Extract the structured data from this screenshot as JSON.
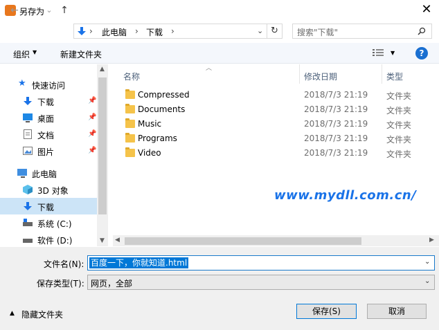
{
  "window": {
    "title": "另存为",
    "close_label": "✕"
  },
  "nav": {
    "back": "←",
    "forward": "→",
    "dropdown": "⌄",
    "up": "↑",
    "breadcrumb": [
      "此电脑",
      "下载"
    ],
    "sep": "›",
    "refresh": "↻",
    "search_placeholder": "搜索\"下载\""
  },
  "toolbar": {
    "organize": "组织",
    "new_folder": "新建文件夹",
    "help": "?"
  },
  "sidebar": {
    "items": [
      {
        "label": "快速访问",
        "icon": "star-icon",
        "pinned": false
      },
      {
        "label": "下载",
        "icon": "download-icon",
        "pinned": true
      },
      {
        "label": "桌面",
        "icon": "desktop-icon",
        "pinned": true
      },
      {
        "label": "文档",
        "icon": "document-icon",
        "pinned": true
      },
      {
        "label": "图片",
        "icon": "picture-icon",
        "pinned": true
      },
      {
        "label": "此电脑",
        "icon": "computer-icon",
        "pinned": false
      },
      {
        "label": "3D 对象",
        "icon": "cube-icon",
        "pinned": false
      },
      {
        "label": "下载",
        "icon": "download-icon",
        "pinned": false,
        "selected": true
      },
      {
        "label": "系统 (C:)",
        "icon": "drive-icon",
        "pinned": false
      },
      {
        "label": "软件 (D:)",
        "icon": "drive-icon",
        "pinned": false
      }
    ]
  },
  "columns": {
    "name": "名称",
    "date": "修改日期",
    "type": "类型"
  },
  "files": [
    {
      "name": "Compressed",
      "date": "2018/7/3 21:19",
      "type": "文件夹"
    },
    {
      "name": "Documents",
      "date": "2018/7/3 21:19",
      "type": "文件夹"
    },
    {
      "name": "Music",
      "date": "2018/7/3 21:19",
      "type": "文件夹"
    },
    {
      "name": "Programs",
      "date": "2018/7/3 21:19",
      "type": "文件夹"
    },
    {
      "name": "Video",
      "date": "2018/7/3 21:19",
      "type": "文件夹"
    }
  ],
  "watermark": "www.mydll.com.cn/",
  "form": {
    "filename_label": "文件名(N):",
    "filename_value": "百度一下，你就知道.html",
    "type_label": "保存类型(T):",
    "type_value": "网页，全部"
  },
  "footer": {
    "hide_folders": "隐藏文件夹",
    "save": "保存(S)",
    "cancel": "取消"
  },
  "colors": {
    "accent": "#0078d7",
    "watermark": "#1a73e8",
    "folder": "#f5c34a"
  }
}
